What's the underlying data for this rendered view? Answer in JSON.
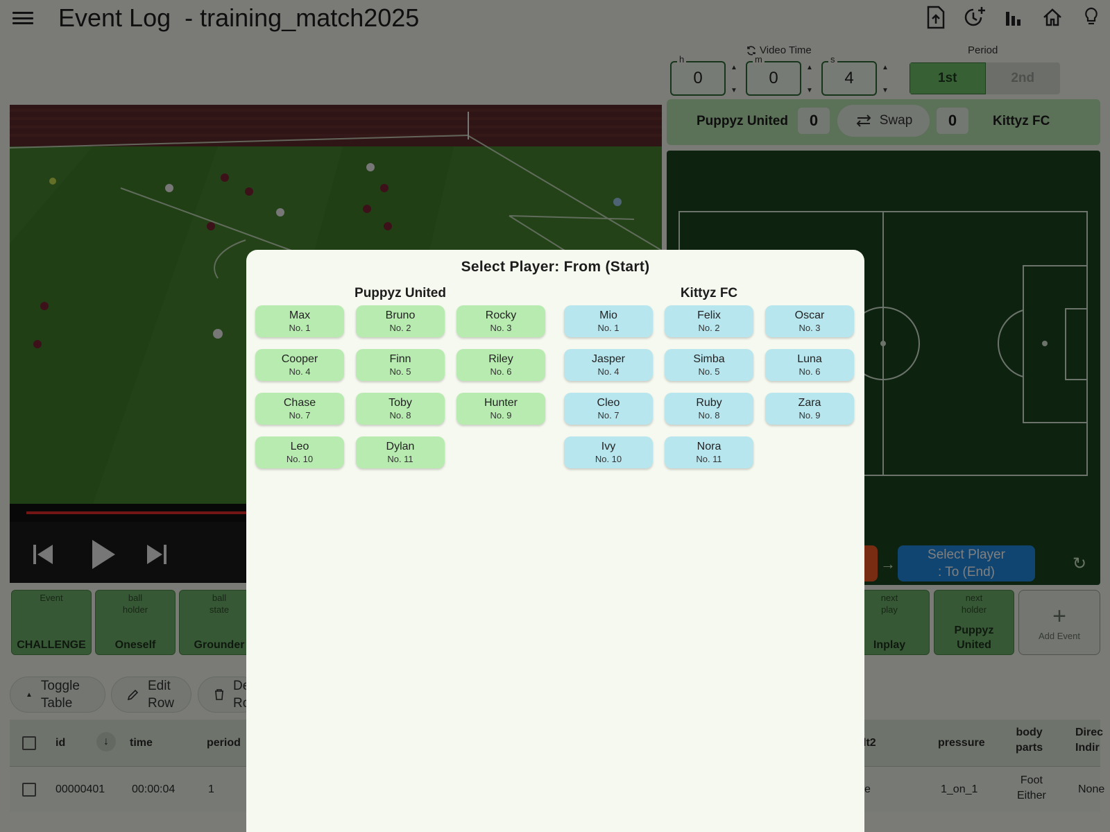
{
  "app": {
    "title": "Event Log  - training_match2025"
  },
  "toolbar": {
    "icons": [
      "export-icon",
      "timer-add-icon",
      "stats-icon",
      "home-icon",
      "lightbulb-icon"
    ]
  },
  "video_time": {
    "label": "Video Time",
    "h_label": "h",
    "m_label": "m",
    "s_label": "s",
    "h": "0",
    "m": "0",
    "s": "4"
  },
  "period": {
    "label": "Period",
    "options": [
      "1st",
      "2nd"
    ],
    "selected": "1st"
  },
  "scoreboard": {
    "home_team": "Puppyz United",
    "home_score": "0",
    "away_team": "Kittyz FC",
    "away_score": "0",
    "swap_label": "Swap"
  },
  "video": {
    "progress": 0.36
  },
  "pitch": {
    "to_button": "Select Player\n: To (End)"
  },
  "event_chips": [
    {
      "key": "Event",
      "value": "CHALLENGE"
    },
    {
      "key": "ball\nholder",
      "value": "Oneself"
    },
    {
      "key": "ball\nstate",
      "value": "Grounder"
    },
    {
      "key": "next\nplay",
      "value": "Inplay"
    },
    {
      "key": "next\nholder",
      "value": "Puppyz\nUnited"
    }
  ],
  "add_event_label": "Add Event",
  "table_actions": {
    "toggle": "Toggle\nTable",
    "edit": "Edit\nRow",
    "delete_partial": "De\nRo"
  },
  "table": {
    "headers": {
      "id": "id",
      "time": "time",
      "period": "period",
      "result2": "lt2",
      "pressure": "pressure",
      "body_parts": "body\nparts",
      "direction": "Direc\nIndir"
    },
    "row": {
      "id": "00000401",
      "time": "00:00:04",
      "period": "1",
      "result2": "e",
      "pressure": "1_on_1",
      "body_parts": "Foot\nEither",
      "direction": "None"
    }
  },
  "dialog": {
    "title": "Select Player: From (Start)",
    "home": {
      "name": "Puppyz United",
      "players": [
        {
          "name": "Max",
          "no": "No. 1"
        },
        {
          "name": "Bruno",
          "no": "No. 2"
        },
        {
          "name": "Rocky",
          "no": "No. 3"
        },
        {
          "name": "Cooper",
          "no": "No. 4"
        },
        {
          "name": "Finn",
          "no": "No. 5"
        },
        {
          "name": "Riley",
          "no": "No. 6"
        },
        {
          "name": "Chase",
          "no": "No. 7"
        },
        {
          "name": "Toby",
          "no": "No. 8"
        },
        {
          "name": "Hunter",
          "no": "No. 9"
        },
        {
          "name": "Leo",
          "no": "No. 10"
        },
        {
          "name": "Dylan",
          "no": "No. 11"
        }
      ]
    },
    "away": {
      "name": "Kittyz FC",
      "players": [
        {
          "name": "Mio",
          "no": "No. 1"
        },
        {
          "name": "Felix",
          "no": "No. 2"
        },
        {
          "name": "Oscar",
          "no": "No. 3"
        },
        {
          "name": "Jasper",
          "no": "No. 4"
        },
        {
          "name": "Simba",
          "no": "No. 5"
        },
        {
          "name": "Luna",
          "no": "No. 6"
        },
        {
          "name": "Cleo",
          "no": "No. 7"
        },
        {
          "name": "Ruby",
          "no": "No. 8"
        },
        {
          "name": "Zara",
          "no": "No. 9"
        },
        {
          "name": "Ivy",
          "no": "No. 10"
        },
        {
          "name": "Nora",
          "no": "No. 11"
        }
      ]
    }
  }
}
